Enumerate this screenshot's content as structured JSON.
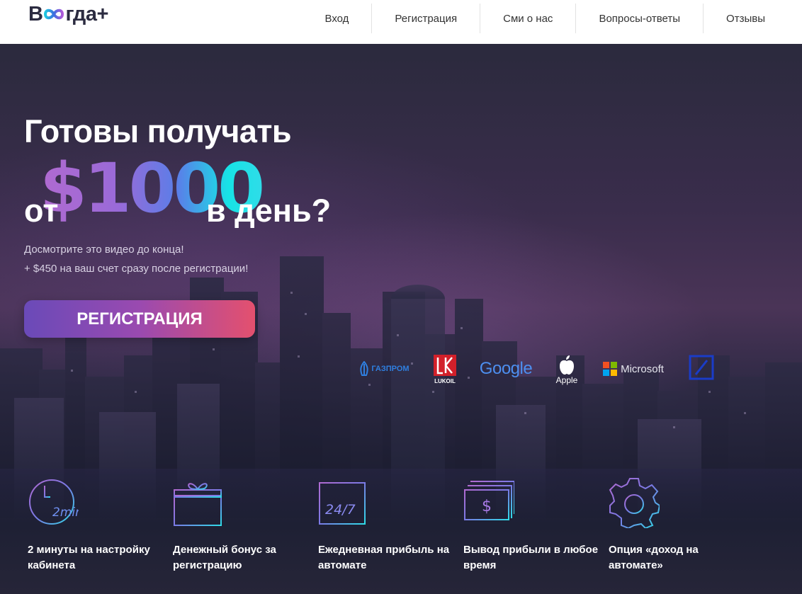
{
  "header": {
    "logo_left": "В",
    "logo_right": "гда+",
    "logo_full": "Всегда+",
    "nav": [
      "Вход",
      "Регистрация",
      "Сми о нас",
      "Вопросы-ответы",
      "Отзывы"
    ]
  },
  "hero": {
    "title_line1": "Готовы получать",
    "title_prefix": "от",
    "amount": "$1000",
    "title_suffix": "в день?",
    "subtitle_lines": [
      "Досмотрите это видео до конца!",
      "+ $450 на ваш счет сразу после регистрации!"
    ],
    "cta_label": "РЕГИСТРАЦИЯ"
  },
  "partners": {
    "gazprom": "ГАЗПРОМ",
    "lukoil": "LUKOIL",
    "google": "Google",
    "apple": "Apple",
    "microsoft": "Microsoft"
  },
  "features": [
    {
      "label": "2 минуты на настройку кабинета",
      "icon": "clock-icon",
      "icon_text": "2min"
    },
    {
      "label": "Денежный бонус за регистрацию",
      "icon": "gift-icon",
      "icon_text": ""
    },
    {
      "label": "Ежедневная прибыль на автомате",
      "icon": "calendar-icon",
      "icon_text": "24/7"
    },
    {
      "label": "Вывод прибыли в любое время",
      "icon": "money-stack-icon",
      "icon_text": "$"
    },
    {
      "label": "Опция «доход на автомате»",
      "icon": "gear-icon",
      "icon_text": ""
    }
  ],
  "colors": {
    "accent_start": "#6a4ab8",
    "accent_end": "#e4506e",
    "icon_gradient_start": "#b06ad0",
    "icon_gradient_end": "#2fdce8"
  }
}
